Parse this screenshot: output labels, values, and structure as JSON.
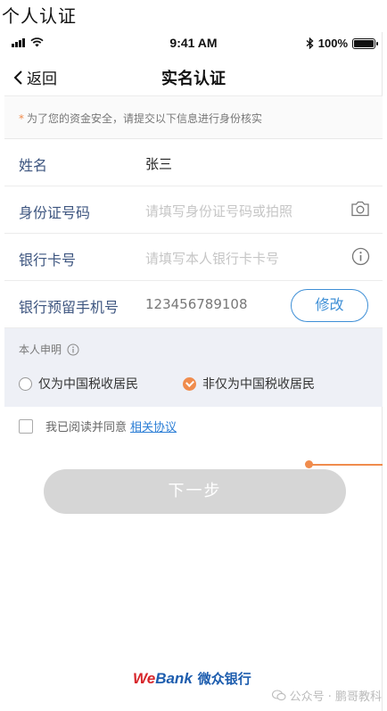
{
  "caption": "个人认证",
  "status_bar": {
    "time": "9:41 AM",
    "battery": "100%"
  },
  "nav": {
    "back_label": "返回",
    "title": "实名认证"
  },
  "notice": {
    "marker": "*",
    "text": "为了您的资金安全，请提交以下信息进行身份核实"
  },
  "form": {
    "name_label": "姓名",
    "name_value": "张三",
    "id_label": "身份证号码",
    "id_placeholder": "请填写身份证号码或拍照",
    "card_label": "银行卡号",
    "card_placeholder": "请填写本人银行卡卡号",
    "phone_label": "银行预留手机号",
    "phone_value": "123456789108",
    "modify_label": "修改"
  },
  "declaration": {
    "title": "本人申明",
    "options": [
      {
        "label": "仅为中国税收居民",
        "selected": false
      },
      {
        "label": "非仅为中国税收居民",
        "selected": true
      }
    ]
  },
  "agreement": {
    "text": "我已阅读并同意",
    "link": "相关协议",
    "checked": false
  },
  "next_button": "下一步",
  "brand": {
    "we": "We",
    "bank": "Bank",
    "cn": "微众银行"
  },
  "watermark": "公众号 · 鹏哥教科",
  "colors": {
    "accent_blue": "#3e8fd6",
    "accent_orange": "#f08c4d",
    "label_blue": "#3e5680",
    "disabled_gray": "#d6d6d6"
  }
}
